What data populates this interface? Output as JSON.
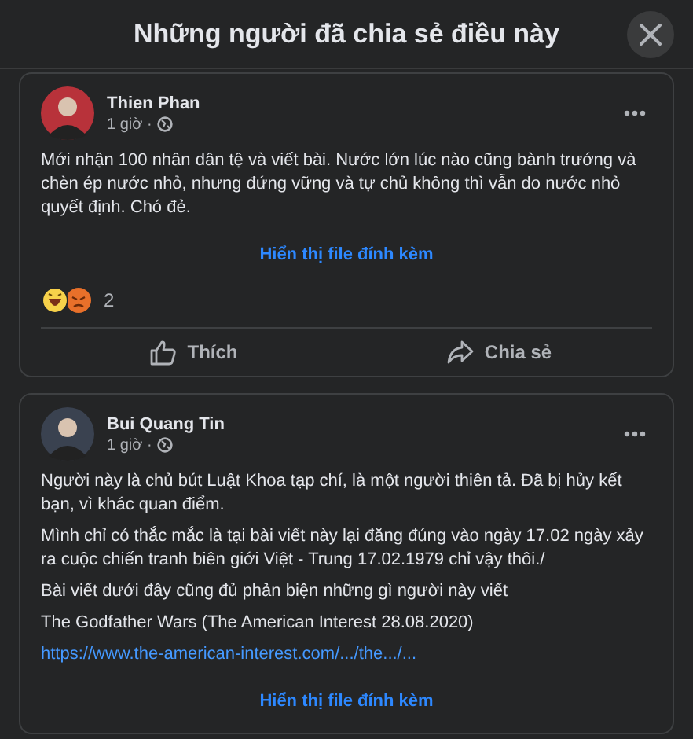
{
  "title": "Những người đã chia sẻ điều này",
  "posts": [
    {
      "author": "Thien Phan",
      "time": "1 giờ ·",
      "color": "#b8323a",
      "paragraphs": [
        {
          "kind": "text",
          "text": "Mới nhận 100 nhân dân tệ và viết bài. Nước lớn lúc nào cũng bành trướng và chèn ép nước nhỏ, nhưng đứng vững và tự chủ không thì vẫn do nước nhỏ quyết định. Chó đẻ."
        }
      ],
      "attachment_link": "Hiển thị file đính kèm",
      "reactions": {
        "count": "2"
      },
      "actions": [
        {
          "kind": "like",
          "label": "Thích"
        },
        {
          "kind": "share",
          "label": "Chia sẻ"
        }
      ]
    },
    {
      "author": "Bui Quang Tin",
      "time": "1 giờ ·",
      "color": "#3a4250",
      "paragraphs": [
        {
          "kind": "text",
          "text": "Người này là chủ bút Luật Khoa tạp chí, là một người thiên tả. Đã bị hủy kết bạn, vì khác quan điểm."
        },
        {
          "kind": "text",
          "text": "Mình chỉ có thắc mắc là tại bài viết này lại đăng đúng vào ngày 17.02 ngày xảy ra cuộc chiến tranh biên giới Việt - Trung 17.02.1979 chỉ vậy thôi./"
        },
        {
          "kind": "text",
          "text": "Bài viết dưới đây cũng đủ phản biện những gì người này viết"
        },
        {
          "kind": "text",
          "text": " The Godfather Wars (The American Interest 28.08.2020)"
        },
        {
          "kind": "link",
          "text": "https://www.the-american-interest.com/.../the.../..."
        }
      ],
      "attachment_link": "Hiển thị file đính kèm"
    }
  ]
}
